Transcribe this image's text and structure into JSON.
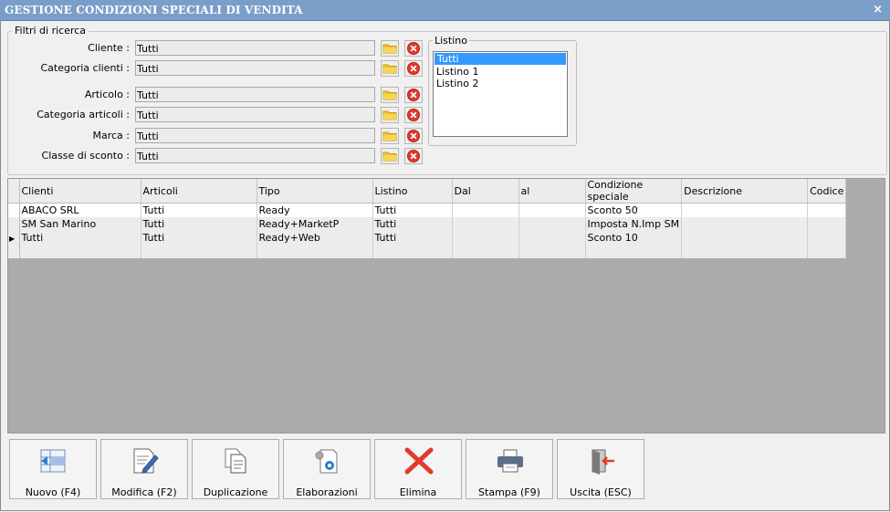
{
  "window": {
    "title": "GESTIONE CONDIZIONI SPECIALI DI VENDITA",
    "close_glyph": "×"
  },
  "filters": {
    "group_title": "Filtri di ricerca",
    "rows": [
      {
        "label": "Cliente :",
        "value": "Tutti"
      },
      {
        "label": "Categoria clienti :",
        "value": "Tutti"
      },
      {
        "label": "Articolo :",
        "value": "Tutti"
      },
      {
        "label": "Categoria articoli :",
        "value": "Tutti"
      },
      {
        "label": "Marca :",
        "value": "Tutti"
      },
      {
        "label": "Classe di sconto :",
        "value": "Tutti"
      }
    ]
  },
  "listino": {
    "title": "Listino",
    "items": [
      "Tutti",
      "Listino 1",
      "Listino 2"
    ],
    "selected": "Tutti"
  },
  "grid": {
    "columns": [
      "Clienti",
      "Articoli",
      "Tipo",
      "Listino",
      "Dal",
      "al",
      "Condizione speciale",
      "Descrizione",
      "Codice"
    ],
    "rows": [
      [
        "ABACO SRL",
        "Tutti",
        "Ready",
        "Tutti",
        "",
        "",
        "Sconto 50",
        "",
        ""
      ],
      [
        "SM San Marino",
        "Tutti",
        "Ready+MarketP",
        "Tutti",
        "",
        "",
        "Imposta N.Imp SM",
        "",
        ""
      ],
      [
        "Tutti",
        "Tutti",
        "Ready+Web",
        "Tutti",
        "",
        "",
        "Sconto 10",
        "",
        ""
      ],
      [
        "",
        "",
        "",
        "",
        "",
        "",
        "",
        "",
        ""
      ]
    ],
    "current_row_glyph": "▶"
  },
  "toolbar": {
    "buttons": [
      {
        "label": "Nuovo (F4)",
        "icon": "new-record-icon"
      },
      {
        "label": "Modifica (F2)",
        "icon": "edit-document-icon"
      },
      {
        "label": "Duplicazione",
        "icon": "copy-documents-icon"
      },
      {
        "label": "Elaborazioni",
        "icon": "process-gear-icon"
      },
      {
        "label": "Elimina",
        "icon": "delete-x-icon"
      },
      {
        "label": "Stampa (F9)",
        "icon": "printer-icon"
      },
      {
        "label": "Uscita (ESC)",
        "icon": "exit-door-icon"
      }
    ]
  },
  "colors": {
    "titlebar": "#7b9ec9",
    "selection": "#3399ff",
    "clear_red": "#e03b2c",
    "folder_yellow": "#f2c230"
  }
}
